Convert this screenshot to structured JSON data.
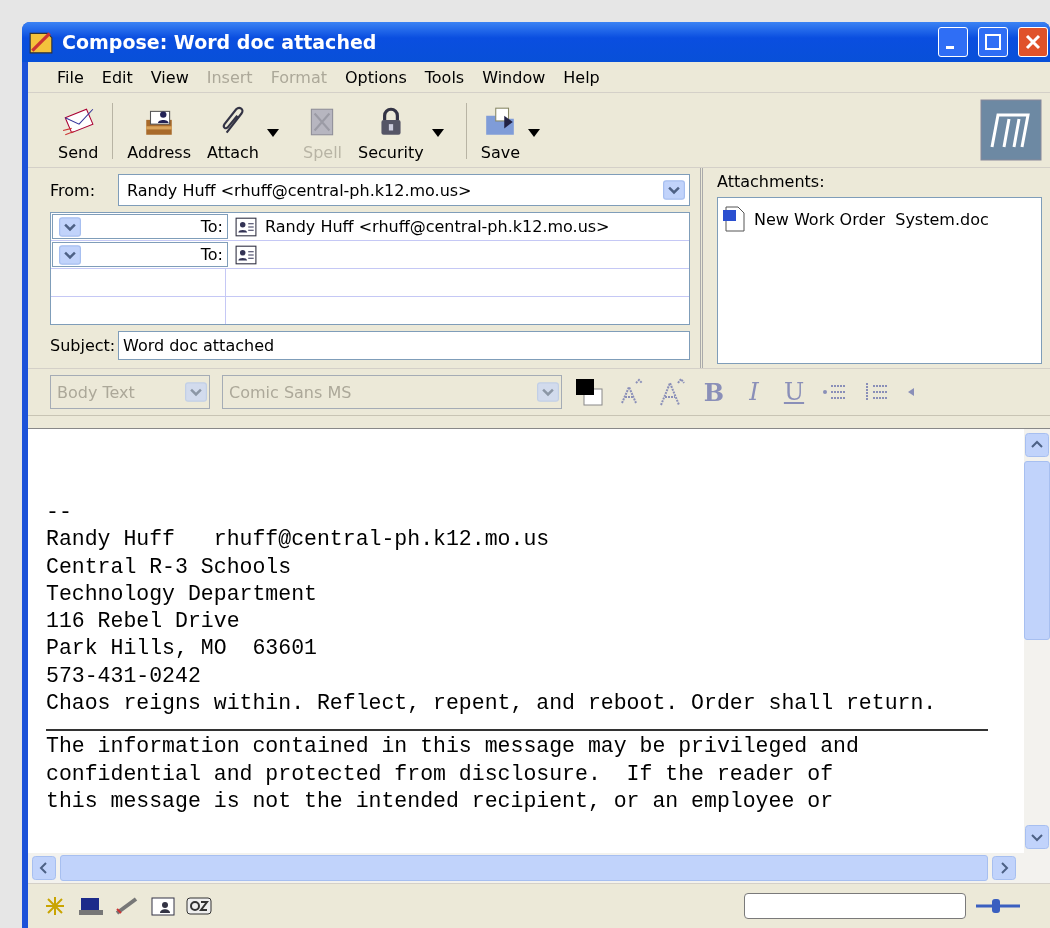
{
  "window": {
    "title": "Compose: Word doc attached"
  },
  "menu": [
    {
      "label": "File",
      "disabled": false
    },
    {
      "label": "Edit",
      "disabled": false
    },
    {
      "label": "View",
      "disabled": false
    },
    {
      "label": "Insert",
      "disabled": true
    },
    {
      "label": "Format",
      "disabled": true
    },
    {
      "label": "Options",
      "disabled": false
    },
    {
      "label": "Tools",
      "disabled": false
    },
    {
      "label": "Window",
      "disabled": false
    },
    {
      "label": "Help",
      "disabled": false
    }
  ],
  "toolbar": [
    {
      "kind": "send",
      "label": "Send",
      "disabled": false,
      "dropdown": false
    },
    {
      "kind": "address",
      "label": "Address",
      "disabled": false,
      "dropdown": false
    },
    {
      "kind": "attach",
      "label": "Attach",
      "disabled": false,
      "dropdown": true
    },
    {
      "kind": "spell",
      "label": "Spell",
      "disabled": true,
      "dropdown": false
    },
    {
      "kind": "security",
      "label": "Security",
      "disabled": false,
      "dropdown": true
    },
    {
      "kind": "save",
      "label": "Save",
      "disabled": false,
      "dropdown": true
    }
  ],
  "from": {
    "label": "From:",
    "value": "Randy Huff <rhuff@central-ph.k12.mo.us>"
  },
  "recipients": [
    {
      "type": "To:",
      "value": "Randy Huff <rhuff@central-ph.k12.mo.us>"
    },
    {
      "type": "To:"
    }
  ],
  "subject": {
    "label": "Subject:",
    "value": "Word doc attached"
  },
  "attachments": {
    "label": "Attachments:",
    "items": [
      "New Work Order  System.doc"
    ]
  },
  "format_bar": {
    "paragraph_style": "Body Text",
    "font": "Comic Sans MS",
    "disabled": true,
    "bold": "B",
    "italic": "I",
    "underline": "U"
  },
  "body": {
    "signature": [
      "--",
      "Randy Huff   rhuff@central-ph.k12.mo.us",
      "Central R-3 Schools",
      "Technology Department",
      "116 Rebel Drive",
      "Park Hills, MO  63601",
      "573-431-0242",
      "Chaos reigns within. Reflect, repent, and reboot. Order shall return."
    ],
    "disclaimer": [
      "The information contained in this message may be privileged and",
      "confidential and protected from disclosure.  If the reader of",
      "this message is not the intended recipient, or an employee or"
    ]
  }
}
